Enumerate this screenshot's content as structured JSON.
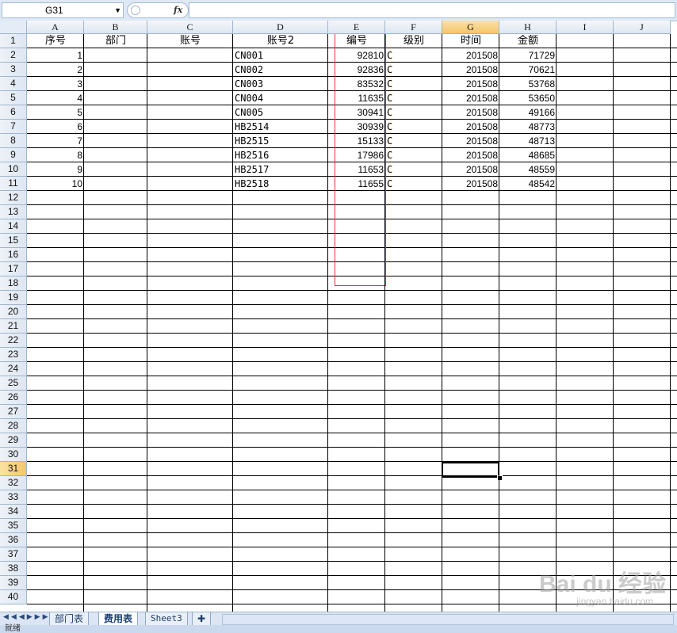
{
  "formula_bar": {
    "name_box": "G31",
    "fx_label": "fx",
    "formula": ""
  },
  "columns": [
    "A",
    "B",
    "C",
    "D",
    "E",
    "F",
    "G",
    "H",
    "I",
    "J"
  ],
  "selected_column": "G",
  "rows": [
    "1",
    "2",
    "3",
    "4",
    "5",
    "6",
    "7",
    "8",
    "9",
    "10",
    "11",
    "12",
    "13",
    "14",
    "15",
    "16",
    "17",
    "18",
    "19",
    "20",
    "21",
    "22",
    "23",
    "24",
    "25",
    "26",
    "27",
    "28",
    "29",
    "30",
    "31",
    "32",
    "33",
    "34",
    "35",
    "36",
    "37",
    "38",
    "39",
    "40"
  ],
  "selected_row": "31",
  "headers": {
    "A": "序号",
    "B": "部门",
    "C": "账号",
    "D": "账号2",
    "E": "编号",
    "F": "级别",
    "G": "时间",
    "H": "金额"
  },
  "table": [
    {
      "A": "1",
      "D": "CN001",
      "E": "92810",
      "F": "C",
      "G": "201508",
      "H": "71729"
    },
    {
      "A": "2",
      "D": "CN002",
      "E": "92836",
      "F": "C",
      "G": "201508",
      "H": "70621"
    },
    {
      "A": "3",
      "D": "CN003",
      "E": "83532",
      "F": "C",
      "G": "201508",
      "H": "53768"
    },
    {
      "A": "4",
      "D": "CN004",
      "E": "11635",
      "F": "C",
      "G": "201508",
      "H": "53650"
    },
    {
      "A": "5",
      "D": "CN005",
      "E": "30941",
      "F": "C",
      "G": "201508",
      "H": "49166"
    },
    {
      "A": "6",
      "D": "HB2514",
      "E": "30939",
      "F": "C",
      "G": "201508",
      "H": "48773"
    },
    {
      "A": "7",
      "D": "HB2515",
      "E": "15133",
      "F": "C",
      "G": "201508",
      "H": "48713"
    },
    {
      "A": "8",
      "D": "HB2516",
      "E": "17986",
      "F": "C",
      "G": "201508",
      "H": "48685"
    },
    {
      "A": "9",
      "D": "HB2517",
      "E": "11653",
      "F": "C",
      "G": "201508",
      "H": "48559"
    },
    {
      "A": "10",
      "D": "HB2518",
      "E": "11655",
      "F": "C",
      "G": "201508",
      "H": "48542"
    }
  ],
  "sheet_tabs": [
    "部门表",
    "费用表",
    "Sheet3"
  ],
  "active_tab": "费用表",
  "status_text": "就绪",
  "watermark": {
    "brand": "Bai du 经验",
    "url": "jingyan.baidu.com"
  },
  "colors": {
    "highlight_box": "#e8343a",
    "selected_header": "#f5c56c"
  }
}
